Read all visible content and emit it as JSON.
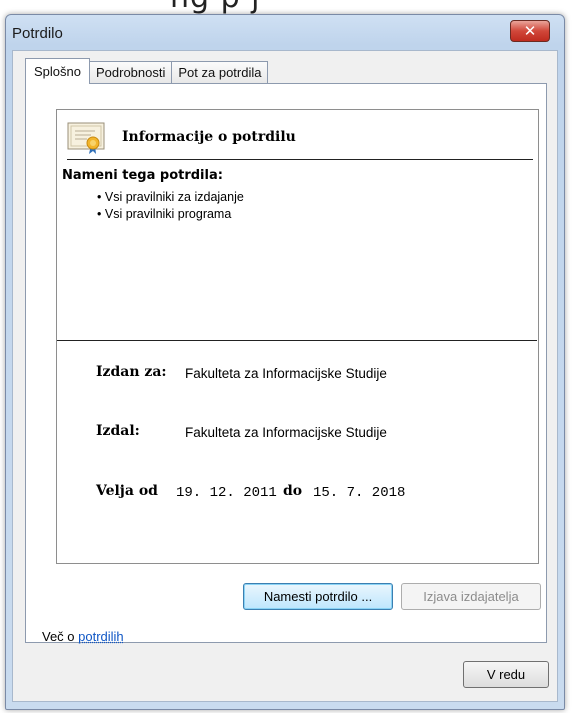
{
  "cropped_header_text": "ng   p     j",
  "window": {
    "title": "Potrdilo",
    "close_label": "✕"
  },
  "tabs": [
    {
      "label": "Splošno",
      "active": true
    },
    {
      "label": "Podrobnosti",
      "active": false
    },
    {
      "label": "Pot za potrdila",
      "active": false
    }
  ],
  "certificate": {
    "icon": "certificate-icon",
    "info_title": "Informacije o potrdilu",
    "purposes_heading": "Nameni tega potrdila:",
    "purposes": [
      "Vsi pravilniki za izdajanje",
      "Vsi pravilniki programa"
    ],
    "issued_to_label": "Izdan za:",
    "issued_to_value": "Fakulteta za Informacijske Studije",
    "issued_by_label": "Izdal:",
    "issued_by_value": "Fakulteta za Informacijske Studije",
    "valid_from_label": "Velja od",
    "valid_from_value": "19. 12. 2011",
    "valid_to_label": "do",
    "valid_to_value": "15. 7. 2018"
  },
  "buttons": {
    "install_label": "Namesti potrdilo ...",
    "issuer_statement_label": "Izjava izdajatelja",
    "ok_label": "V redu"
  },
  "more_info": {
    "prefix": "Več o ",
    "link": "potrdilih"
  },
  "colors": {
    "link": "#0f56c5",
    "close_button": "#c7392c",
    "title_bar": "#c9dbef"
  }
}
